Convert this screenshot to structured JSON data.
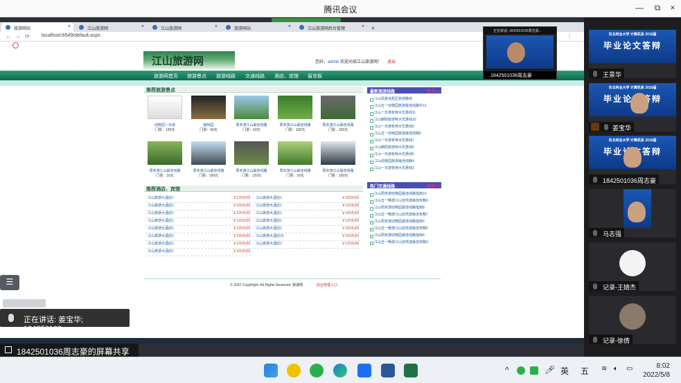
{
  "app": {
    "title": "腾讯会议"
  },
  "window_controls": [
    "—",
    "⧉",
    "×"
  ],
  "browser": {
    "tabs": [
      {
        "label": "旅游网站",
        "active": true
      },
      {
        "label": "江山旅游网"
      },
      {
        "label": "江山旅游网"
      },
      {
        "label": "旅游网站"
      },
      {
        "label": "江山旅游网后台管理"
      }
    ],
    "url": "localhost:6549/default.aspx"
  },
  "site": {
    "logo": "江山旅游网",
    "welcome_prefix": "您好，",
    "user": "admin",
    "welcome_suffix": "欢迎光临江山旅游网！",
    "logout": "退出",
    "menu": [
      "旅游网首页",
      "旅游景点",
      "旅游线路",
      "交通线路",
      "酒店、宾馆",
      "留言板"
    ],
    "attractions_title": "推荐旅游景点",
    "attractions": [
      {
        "name": "动物园一日游",
        "price": "门票：120元"
      },
      {
        "name": "植物园",
        "price": "门票：60元"
      },
      {
        "name": "周末游江山最佳线路",
        "price": "门票：60元"
      },
      {
        "name": "周末游江山最佳线路",
        "price": "门票：120元"
      },
      {
        "name": "周末游江山最佳线路",
        "price": "门票：320元"
      },
      {
        "name": "周末游江山最佳线路",
        "price": "门票：16元"
      },
      {
        "name": "周末游江山最佳线路",
        "price": "门票：100元"
      },
      {
        "name": "周末游江山最佳线路",
        "price": "门票：120元"
      },
      {
        "name": "周末游江山最佳线路",
        "price": "门票：16元"
      },
      {
        "name": "周末游江山最佳线路",
        "price": "门票：100元"
      }
    ],
    "hotels_title": "推荐酒店、宾馆",
    "hotels_left": [
      {
        "name": "江山旅游大酒店1",
        "price": "￥120元/间"
      },
      {
        "name": "江山旅游大酒店1",
        "price": "￥160元/间"
      },
      {
        "name": "江山旅游大酒店1",
        "price": "￥120元/间"
      },
      {
        "name": "江山旅游大酒店1",
        "price": "￥120元/间"
      },
      {
        "name": "江山旅游大酒店1",
        "price": "￥120元/间"
      },
      {
        "name": "江山旅游大酒店1",
        "price": "￥160元/间"
      },
      {
        "name": "江山旅游大酒店1",
        "price": "￥120元/间"
      },
      {
        "name": "江山旅游大酒店1",
        "price": "￥160元/间"
      }
    ],
    "hotels_right": [
      {
        "name": "江山旅游大酒店1",
        "price": "￥150元/间"
      },
      {
        "name": "江山旅游大酒店1",
        "price": "￥120元/间"
      },
      {
        "name": "江山旅游大酒店1",
        "price": "￥160元/间"
      },
      {
        "name": "江山旅游大酒店1",
        "price": "￥120元/间"
      },
      {
        "name": "江山旅游大酒店1",
        "price": "￥150元/间"
      },
      {
        "name": "江山旅游大酒店10",
        "price": "￥150元/间"
      },
      {
        "name": "江山旅游大酒店1",
        "price": "￥120元/间"
      }
    ],
    "lines_title": "最新旅游线路",
    "more": "更多>>",
    "lines": [
      "江山风景名胜区旅游路线",
      "江山五一动物园旅游最佳线路中12",
      "江山一日游有特大优惠线11",
      "江山朝阳旅游特大优惠线10",
      "江山一日游有特大优惠线9",
      "江山五一动物园旅游最佳线路8",
      "江山一日游有特大优惠线7",
      "江山朝阳旅游特大优惠线6",
      "江山一日游有特大优惠线5",
      "江山动物园旅游最佳线路4",
      "江山一日游有特大优惠线3"
    ],
    "traffic_title": "热门交通线路",
    "traffic": [
      "江山周末游动物园最佳线路指南10",
      "江山五一畅游江山自驾游最佳攻略9",
      "江山周末游动物园最佳线路指南8",
      "江山五一畅游江山自驾游最佳攻略7",
      "江山周末游动物园最佳线路指南6",
      "江山五一畅游江山自驾游最佳攻略5",
      "江山周末游动物园最佳线路指南4",
      "江山五一畅游江山自驾游最佳攻略3"
    ],
    "footer": "© 2022 CopyRight. All Rights Reserved.  旅游网",
    "admin_link": "后台管理入口"
  },
  "overlays": {
    "speaking": "正在讲话: 姜宝华; 184250103...",
    "share_label": "1842501036周志豪的屏幕共享",
    "mini_speaking": "正在讲话: 1842501036周志豪...",
    "mini_name": "1842501036周志豪",
    "banner_small": "东北林业大学 计算机系 2018届",
    "banner_big": "毕业论文答辩"
  },
  "participants": [
    {
      "name": "王景华"
    },
    {
      "name": "姜宝华"
    },
    {
      "name": "1842501036周志豪"
    },
    {
      "name": "马志强"
    },
    {
      "name": "记录-王婧杰"
    },
    {
      "name": "记录-徐倩"
    }
  ],
  "taskbar": {
    "ime1": "英",
    "ime2": "五",
    "time": "8:02",
    "date": "2022/5/8"
  },
  "colors": {
    "menu": "#0d6c52",
    "panel": "#1d1d1f",
    "banner": "#1b57b3"
  }
}
